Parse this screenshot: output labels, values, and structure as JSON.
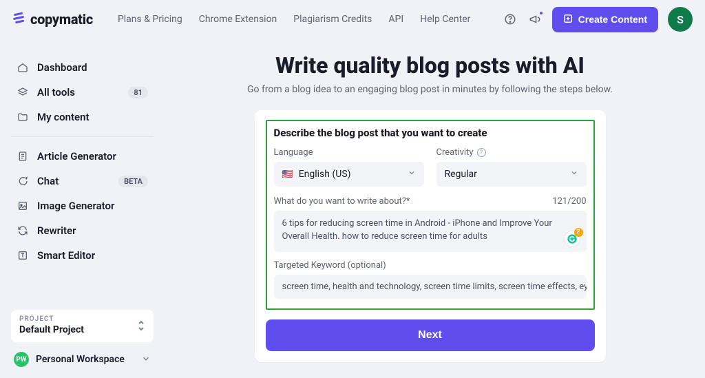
{
  "brand": {
    "name": "copymatic"
  },
  "nav": {
    "plans": "Plans & Pricing",
    "chrome": "Chrome Extension",
    "plagiarism": "Plagiarism Credits",
    "api": "API",
    "help": "Help Center"
  },
  "header": {
    "create_label": "Create Content",
    "avatar_initial": "S"
  },
  "sidebar": {
    "dashboard": "Dashboard",
    "all_tools": "All tools",
    "all_tools_count": "81",
    "my_content": "My content",
    "article_gen": "Article Generator",
    "chat": "Chat",
    "chat_badge": "BETA",
    "image_gen": "Image Generator",
    "rewriter": "Rewriter",
    "smart_editor": "Smart Editor",
    "project_label": "PROJECT",
    "project_name": "Default Project",
    "workspace_badge": "PW",
    "workspace_name": "Personal Workspace"
  },
  "main": {
    "title": "Write quality blog posts with AI",
    "subtitle": "Go from a blog idea to an engaging blog post in minutes by following the steps below.",
    "form_title": "Describe the blog post that you want to create",
    "language_label": "Language",
    "language_value": "English (US)",
    "creativity_label": "Creativity",
    "creativity_value": "Regular",
    "topic_label": "What do you want to write about?*",
    "topic_count": "121/200",
    "topic_value": "6 tips for reducing screen time in Android - iPhone and Improve Your Overall Health. how to reduce screen time for adults",
    "keyword_label": "Targeted Keyword (optional)",
    "keyword_value": "screen time, health and technology, screen time limits, screen time effects, eye",
    "grammarly_badge": "2",
    "next_label": "Next"
  }
}
